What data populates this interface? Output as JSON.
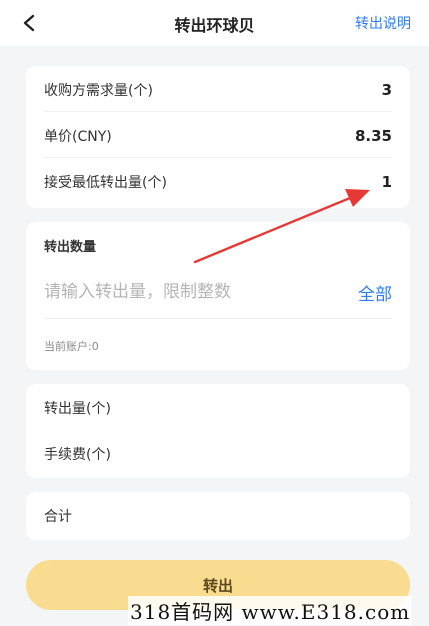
{
  "header": {
    "title": "转出环球贝",
    "explain_label": "转出说明",
    "back_icon": "chevron-left-icon"
  },
  "summary": {
    "rows": [
      {
        "label": "收购方需求量(个)",
        "value": "3"
      },
      {
        "label": "单价(CNY)",
        "value": "8.35"
      },
      {
        "label": "接受最低转出量(个)",
        "value": "1"
      }
    ]
  },
  "transfer": {
    "section_title": "转出数量",
    "input_placeholder": "请输入转出量，限制整数",
    "input_value": "",
    "all_label": "全部",
    "account_info": "当前账户:0"
  },
  "details": {
    "amount_label": "转出量(个)",
    "fee_label": "手续费(个)"
  },
  "total": {
    "label": "合计"
  },
  "submit": {
    "label": "转出"
  },
  "annotation": {
    "arrow_color": "#e53935"
  },
  "watermark": {
    "text": "318首码网 www.E318.com"
  },
  "colors": {
    "accent": "#2f7cf6",
    "button": "#f9dc8f",
    "background": "#f4f5f7"
  }
}
